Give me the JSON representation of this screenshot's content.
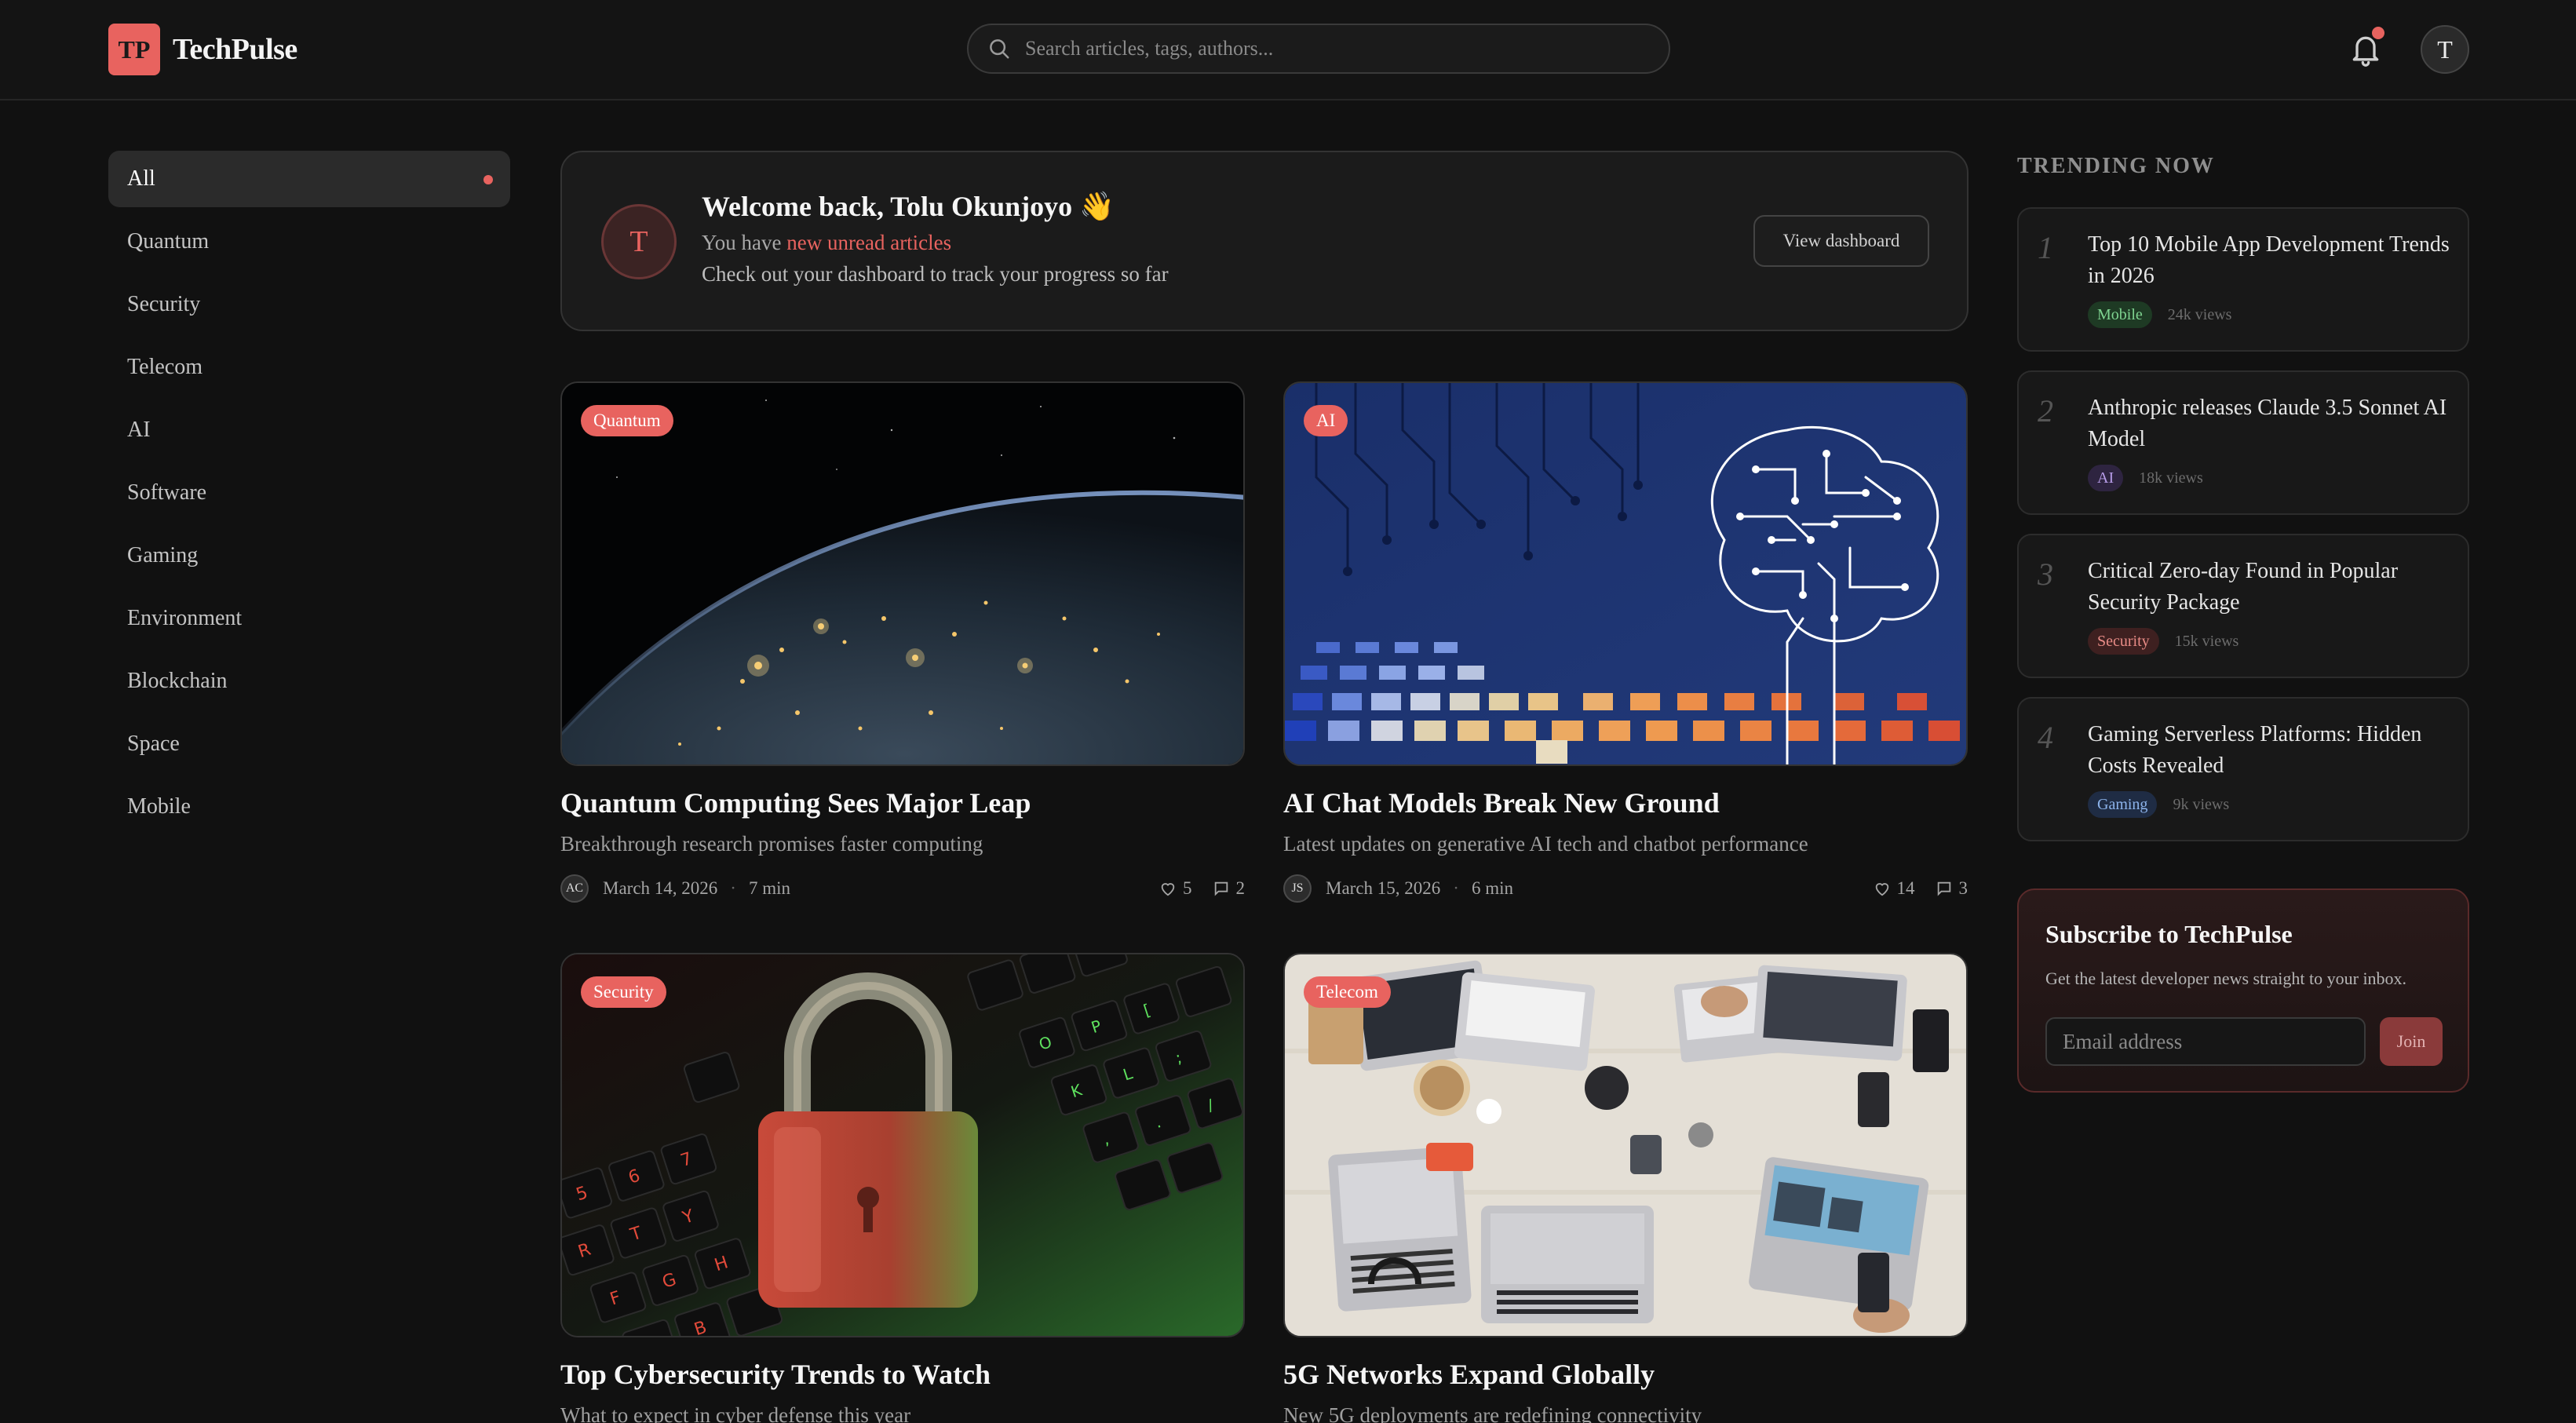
{
  "header": {
    "logo_mark": "TP",
    "brand": "TechPulse",
    "search_placeholder": "Search articles, tags, authors...",
    "avatar_initial": "T",
    "has_notification": true
  },
  "sidebar": {
    "items": [
      {
        "label": "All",
        "active": true
      },
      {
        "label": "Quantum"
      },
      {
        "label": "Security"
      },
      {
        "label": "Telecom"
      },
      {
        "label": "AI"
      },
      {
        "label": "Software"
      },
      {
        "label": "Gaming"
      },
      {
        "label": "Environment"
      },
      {
        "label": "Blockchain"
      },
      {
        "label": "Space"
      },
      {
        "label": "Mobile"
      }
    ]
  },
  "welcome": {
    "avatar_initial": "T",
    "title": "Welcome back, Tolu Okunjoyo 👋",
    "line_prefix": "You have ",
    "line_link": "new unread articles",
    "line2": "Check out your dashboard to track your progress so far",
    "button": "View dashboard"
  },
  "articles": [
    {
      "tag": "Quantum",
      "title": "Quantum Computing Sees Major Leap",
      "desc": "Breakthrough research promises faster computing",
      "author": "AC",
      "date": "March 14, 2026",
      "read": "7 min",
      "likes": "5",
      "comments": "2"
    },
    {
      "tag": "AI",
      "title": "AI Chat Models Break New Ground",
      "desc": "Latest updates on generative AI tech and chatbot performance",
      "author": "JS",
      "date": "March 15, 2026",
      "read": "6 min",
      "likes": "14",
      "comments": "3"
    },
    {
      "tag": "Security",
      "title": "Top Cybersecurity Trends to Watch",
      "desc": "What to expect in cyber defense this year"
    },
    {
      "tag": "Telecom",
      "title": "5G Networks Expand Globally",
      "desc": "New 5G deployments are redefining connectivity"
    }
  ],
  "trending": {
    "heading": "TRENDING NOW",
    "items": [
      {
        "num": "1",
        "title": "Top 10 Mobile App Development Trends in 2026",
        "tag": "Mobile",
        "views": "24k views",
        "tag_bg": "#1e3a24",
        "tag_fg": "#7fd491"
      },
      {
        "num": "2",
        "title": "Anthropic releases Claude 3.5 Sonnet AI Model",
        "tag": "AI",
        "views": "18k views",
        "tag_bg": "#2e2440",
        "tag_fg": "#b79ce8"
      },
      {
        "num": "3",
        "title": "Critical Zero-day Found in Popular Security Package",
        "tag": "Security",
        "views": "15k views",
        "tag_bg": "#3e2020",
        "tag_fg": "#e88b86"
      },
      {
        "num": "4",
        "title": "Gaming Serverless Platforms: Hidden Costs Revealed",
        "tag": "Gaming",
        "views": "9k views",
        "tag_bg": "#1f2c44",
        "tag_fg": "#8db4ec"
      }
    ]
  },
  "subscribe": {
    "title": "Subscribe to TechPulse",
    "desc": "Get the latest developer news straight to your inbox.",
    "placeholder": "Email address",
    "button": "Join"
  },
  "colors": {
    "accent": "#e8635f",
    "background": "#111111",
    "surface": "#1b1b1b"
  }
}
